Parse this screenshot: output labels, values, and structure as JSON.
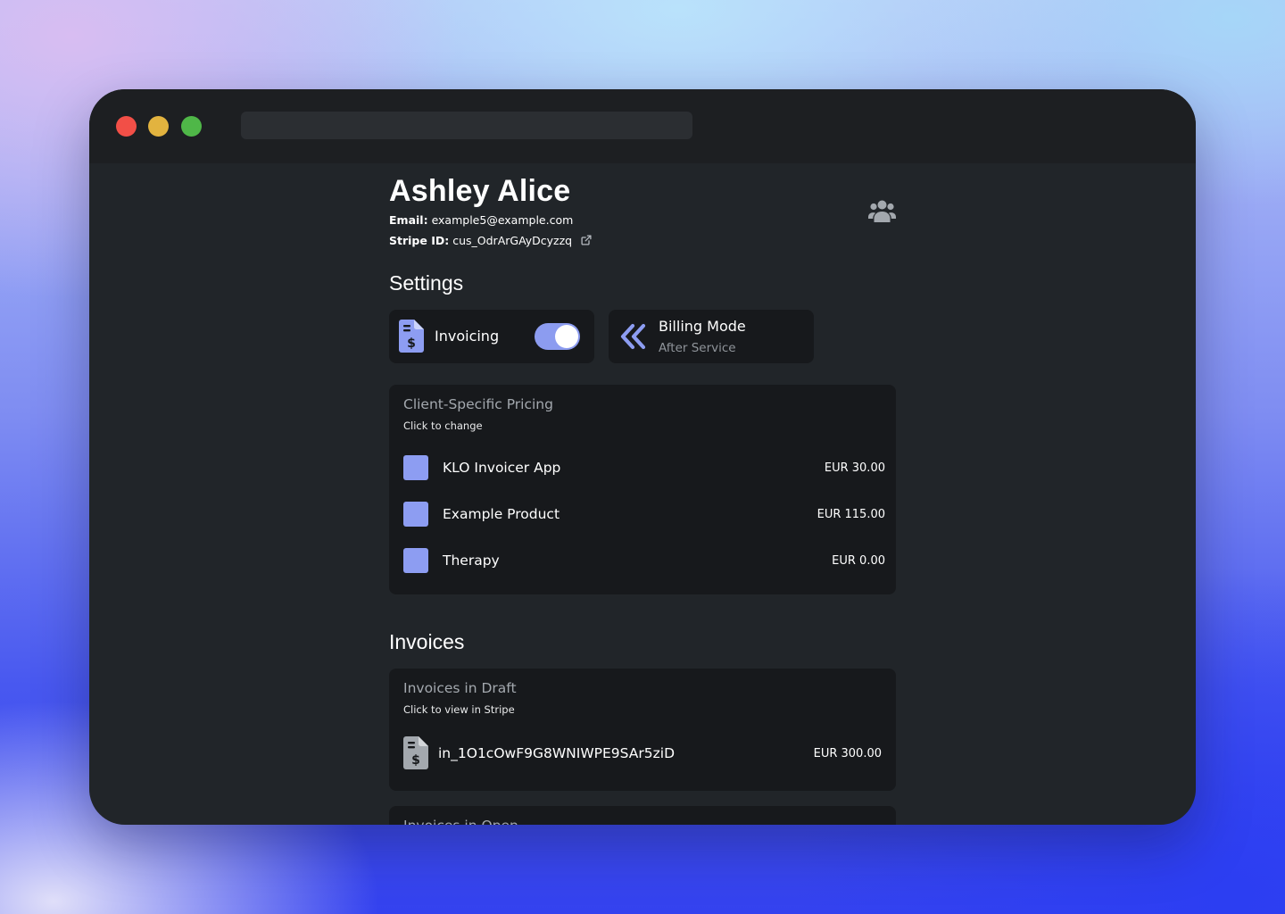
{
  "client": {
    "name": "Ashley Alice",
    "email_label": "Email:",
    "email": "example5@example.com",
    "stripe_label": "Stripe ID:",
    "stripe_id": "cus_OdrArGAyDcyzzq"
  },
  "settings": {
    "title": "Settings",
    "invoicing": {
      "label": "Invoicing",
      "enabled": true
    },
    "billing_mode": {
      "title": "Billing Mode",
      "value": "After Service"
    }
  },
  "pricing": {
    "title": "Client-Specific Pricing",
    "hint": "Click to change",
    "items": [
      {
        "name": "KLO Invoicer App",
        "price": "EUR 30.00"
      },
      {
        "name": "Example Product",
        "price": "EUR 115.00"
      },
      {
        "name": "Therapy",
        "price": "EUR 0.00"
      }
    ]
  },
  "invoices": {
    "title": "Invoices",
    "draft": {
      "title": "Invoices in Draft",
      "hint": "Click to view in Stripe",
      "items": [
        {
          "id": "in_1O1cOwF9G8WNIWPE9SAr5ziD",
          "amount": "EUR 300.00"
        }
      ]
    },
    "open": {
      "title": "Invoices in Open"
    }
  },
  "icons": {
    "external_link": "external-link-icon",
    "users": "users-icon",
    "invoice": "file-invoice-dollar-icon",
    "billing_mode": "double-chevron-left-icon"
  },
  "colors": {
    "accent": "#8c9cf0",
    "window_bg": "#212529",
    "panel_bg": "#17191c"
  }
}
